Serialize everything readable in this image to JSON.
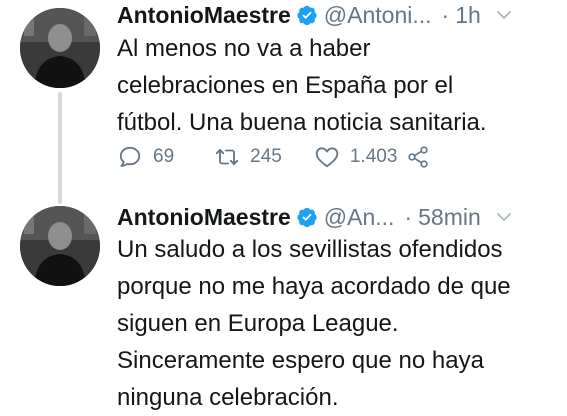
{
  "tweets": [
    {
      "author_name": "AntonioMaestre",
      "handle": "@Antoni...",
      "separator": "·",
      "time": "1h",
      "lines": [
        "Al menos no va a haber",
        "celebraciones en España por el",
        "fútbol. Una buena noticia sanitaria."
      ],
      "stats": {
        "replies": "69",
        "retweets": "245",
        "likes": "1.403"
      }
    },
    {
      "author_name": "AntonioMaestre",
      "handle": "@An...",
      "separator": "·",
      "time": "58min",
      "lines": [
        "Un saludo a los sevillistas ofendidos",
        "porque no me haya acordado de que",
        "siguen en Europa League.",
        "Sinceramente espero que no haya",
        "ninguna celebración."
      ]
    }
  ],
  "icons": {
    "verified": "verified-badge-icon",
    "menu": "chevron-down-icon",
    "reply": "reply-icon",
    "retweet": "retweet-icon",
    "like": "heart-icon",
    "share": "share-icon"
  },
  "colors": {
    "text": "#14171a",
    "secondary": "#657786",
    "verified": "#1da1f2",
    "thread_line": "#d6d9db"
  }
}
